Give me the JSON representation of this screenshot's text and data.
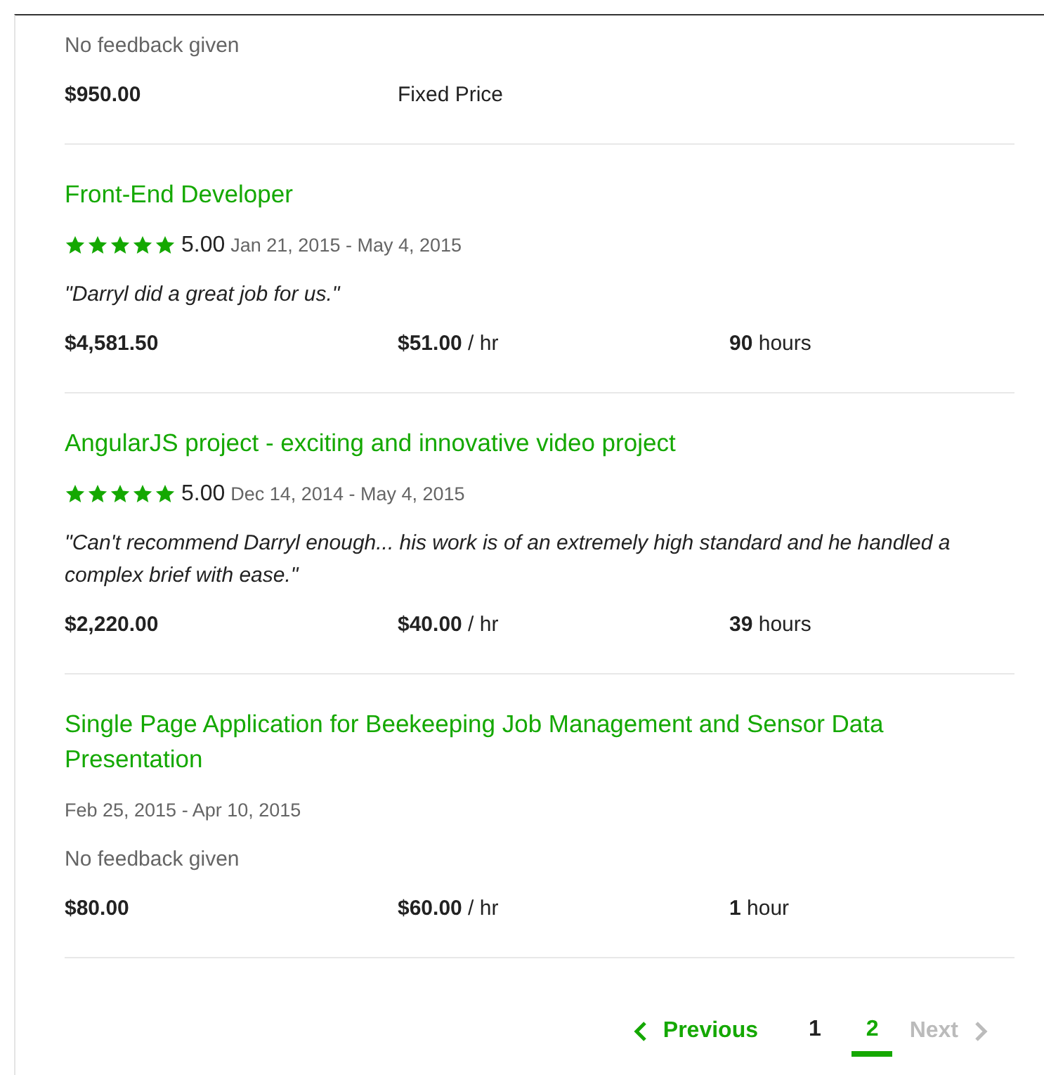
{
  "jobs": [
    {
      "feedback": {
        "text": "No feedback given",
        "given": false
      },
      "amount": "$950.00",
      "terms": "Fixed Price"
    },
    {
      "title": "Front-End Developer",
      "stars": 5,
      "rating": "5.00",
      "dates": "Jan 21, 2015 - May 4, 2015",
      "feedback": {
        "text": "\"Darryl did a great job for us.\"",
        "given": true
      },
      "amount": "$4,581.50",
      "terms": "**$51.00** / hr",
      "hours": "**90** hours"
    },
    {
      "title": "AngularJS project - exciting and innovative video project",
      "stars": 5,
      "rating": "5.00",
      "dates": "Dec 14, 2014 - May 4, 2015",
      "feedback": {
        "text": "\"Can't recommend Darryl enough... his work is of an extremely high standard and he handled a complex brief with ease.\"",
        "given": true
      },
      "amount": "$2,220.00",
      "terms": "**$40.00** / hr",
      "hours": "**39** hours"
    },
    {
      "title": "Single Page Application for Beekeeping Job Management and Sensor Data Presentation",
      "dates": "Feb 25, 2015 - Apr 10, 2015",
      "feedback": {
        "text": "No feedback given",
        "given": false
      },
      "amount": "$80.00",
      "terms": "**$60.00** / hr",
      "hours": "**1** hour"
    }
  ],
  "pagination": {
    "previous": {
      "label": "Previous",
      "disabled": false
    },
    "pages": [
      {
        "label": "1",
        "selected": false
      },
      {
        "label": "2",
        "selected": true
      }
    ],
    "next": {
      "label": "Next",
      "disabled": true
    }
  }
}
